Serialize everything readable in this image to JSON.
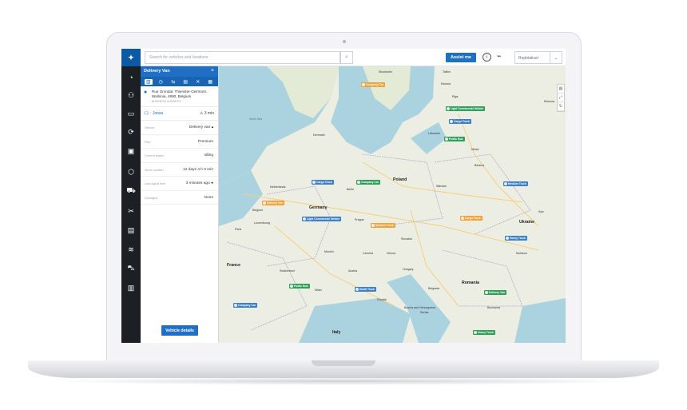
{
  "app": {
    "search_placeholder": "Search for vehicles and locations",
    "assist_label": "Assist me",
    "user_name": "Rephtaliser"
  },
  "rail": {
    "items": [
      "dashboard",
      "user",
      "messages",
      "routes",
      "vehicles",
      "packages",
      "fleet",
      "tools",
      "reports",
      "layers",
      "cars",
      "analytics"
    ]
  },
  "panel": {
    "title": "Delivery Van",
    "close": "×",
    "address_line1": "Rue Grondal, Thierister-Clermont,",
    "address_line2": "Wallonia, 4890, Belgium",
    "address_sub": "BUSINESS ADDRESS",
    "driver": "Jonas",
    "eta": "3 min",
    "rows": [
      {
        "key": "Vehicle",
        "value": "Delivery van ▴"
      },
      {
        "key": "Plan",
        "value": "Premium"
      },
      {
        "key": "Current status",
        "value": "Idling"
      },
      {
        "key": "Since location",
        "value": "12 days 4 h 0 min"
      },
      {
        "key": "Last signal time",
        "value": "3 minutes ago ●"
      },
      {
        "key": "Damages",
        "value": "None"
      }
    ],
    "details_button": "Vehicle details"
  },
  "map": {
    "markers": [
      {
        "label": "Company Car",
        "color": "orange"
      },
      {
        "label": "Light Commercial Vehicle",
        "color": "green"
      },
      {
        "label": "Cargo Truck",
        "color": "blue"
      },
      {
        "label": "Public Bus",
        "color": "green"
      },
      {
        "label": "Cargo Truck",
        "color": "blue"
      },
      {
        "label": "Company Car",
        "color": "green"
      },
      {
        "label": "Medium Truck",
        "color": "blue"
      },
      {
        "label": "Delivery Van",
        "color": "orange"
      },
      {
        "label": "Light Commercial Vehicle",
        "color": "blue"
      },
      {
        "label": "Cargo Truck",
        "color": "orange"
      },
      {
        "label": "Medium Truck",
        "color": "orange"
      },
      {
        "label": "Heavy Truck",
        "color": "blue"
      },
      {
        "label": "Public Bus",
        "color": "green"
      },
      {
        "label": "Small Truck",
        "color": "blue"
      },
      {
        "label": "Delivery Van",
        "color": "green"
      },
      {
        "label": "Company Car",
        "color": "blue"
      },
      {
        "label": "Heavy Truck",
        "color": "green"
      }
    ],
    "countries": [
      "Poland",
      "Germany",
      "France",
      "Ukraine",
      "Romania",
      "Italy"
    ],
    "places": [
      "Estonia",
      "Lithuania",
      "Belarus",
      "Netherlands",
      "Belgium",
      "Luxembourg",
      "Denmark",
      "Czechia",
      "Slovakia",
      "Austria",
      "Hungary",
      "Switzerland",
      "Croatia",
      "Serbia",
      "Moldova",
      "Bosnia and Herzegovina",
      "Minsk",
      "Warsaw",
      "Berlin",
      "Prague",
      "Vienna",
      "Paris",
      "Munich",
      "Milan",
      "Belgrade",
      "Bucharest",
      "Kyiv",
      "North Sea",
      "Stockholm",
      "Tallinn",
      "Riga",
      "Moscow"
    ]
  }
}
